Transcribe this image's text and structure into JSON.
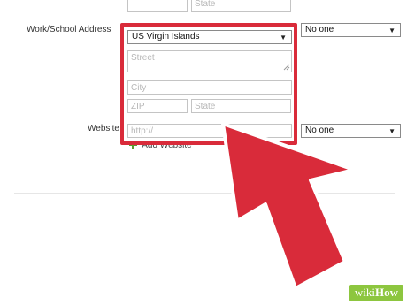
{
  "top_row": {
    "field1_value": "",
    "state_placeholder": "State"
  },
  "work_address": {
    "label": "Work/School Address",
    "country_value": "US Virgin Islands",
    "street_placeholder": "Street",
    "city_placeholder": "City",
    "zip_placeholder": "ZIP",
    "state_placeholder": "State",
    "visibility_value": "No one"
  },
  "website": {
    "label": "Website",
    "url_placeholder": "http://",
    "visibility_value": "No one",
    "add_link": "Add Website"
  },
  "watermark": {
    "part1": "wiki",
    "part2": "How"
  },
  "colors": {
    "highlight": "#d92b3a",
    "arrow": "#d92b3a",
    "add_icon": "#5a9e2f",
    "watermark_bg": "#8dc63f"
  }
}
